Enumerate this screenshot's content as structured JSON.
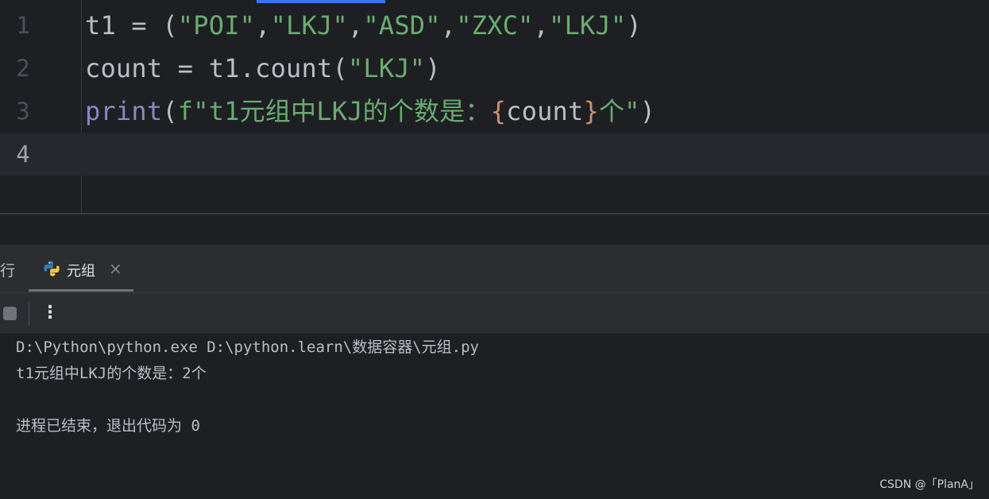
{
  "editor": {
    "lines": [
      {
        "num": "1"
      },
      {
        "num": "2"
      },
      {
        "num": "3"
      },
      {
        "num": "4"
      }
    ],
    "code": {
      "l1": {
        "var": "t1 = (",
        "s1": "\"POI\"",
        "c1": ",",
        "s2": "\"LKJ\"",
        "c2": ",",
        "s3": "\"ASD\"",
        "c3": ",",
        "s4": "\"ZXC\"",
        "c4": ",",
        "s5": "\"LKJ\"",
        "end": ")"
      },
      "l2": {
        "pre": "count = t1.count(",
        "arg": "\"LKJ\"",
        "end": ")"
      },
      "l3": {
        "fn": "print",
        "open": "(",
        "fstr_pre": "f\"t1元组中LKJ的个数是：",
        "lbrace": "{",
        "expr": "count",
        "rbrace": "}",
        "fstr_post": "个\"",
        "close": ")"
      }
    }
  },
  "run_panel": {
    "left_tab_fragment": "行",
    "tab_label": "元组",
    "close_symbol": "×",
    "more_symbol": "⋮",
    "console_lines": [
      "D:\\Python\\python.exe D:\\python.learn\\数据容器\\元组.py",
      "t1元组中LKJ的个数是：2个",
      "",
      "进程已结束，退出代码为 0"
    ]
  },
  "watermark": "CSDN @「PlanA」",
  "colors": {
    "background": "#1e1f22",
    "string": "#6aab73",
    "builtin": "#8888c6",
    "brace": "#cf8e6d",
    "accent": "#3574f0"
  }
}
